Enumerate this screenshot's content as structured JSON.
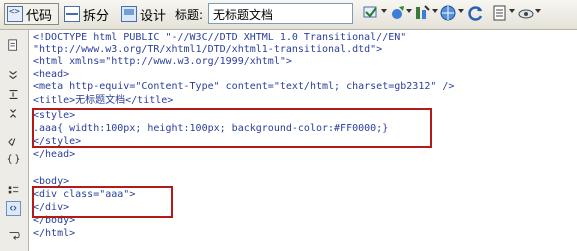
{
  "toolbar": {
    "code_label": "代码",
    "split_label": "拆分",
    "design_label": "设计",
    "title_label": "标题:",
    "title_value": "无标题文档"
  },
  "editor": {
    "lines": [
      "<!DOCTYPE html PUBLIC \"-//W3C//DTD XHTML 1.0 Transitional//EN\"",
      "\"http://www.w3.org/TR/xhtml1/DTD/xhtml1-transitional.dtd\">",
      "<html xmlns=\"http://www.w3.org/1999/xhtml\">",
      "<head>",
      "<meta http-equiv=\"Content-Type\" content=\"text/html; charset=gb2312\" />",
      "<title>无标题文档</title>",
      "<style>",
      ".aaa{ width:100px; height:100px; background-color:#FF0000;}",
      "</style>",
      "</head>",
      "",
      "<body>",
      "<div class=\"aaa\">",
      "</div>",
      "</body>",
      "</html>"
    ]
  },
  "colors": {
    "code_text": "#2a3f9d",
    "highlight_box": "#b31b1b"
  }
}
